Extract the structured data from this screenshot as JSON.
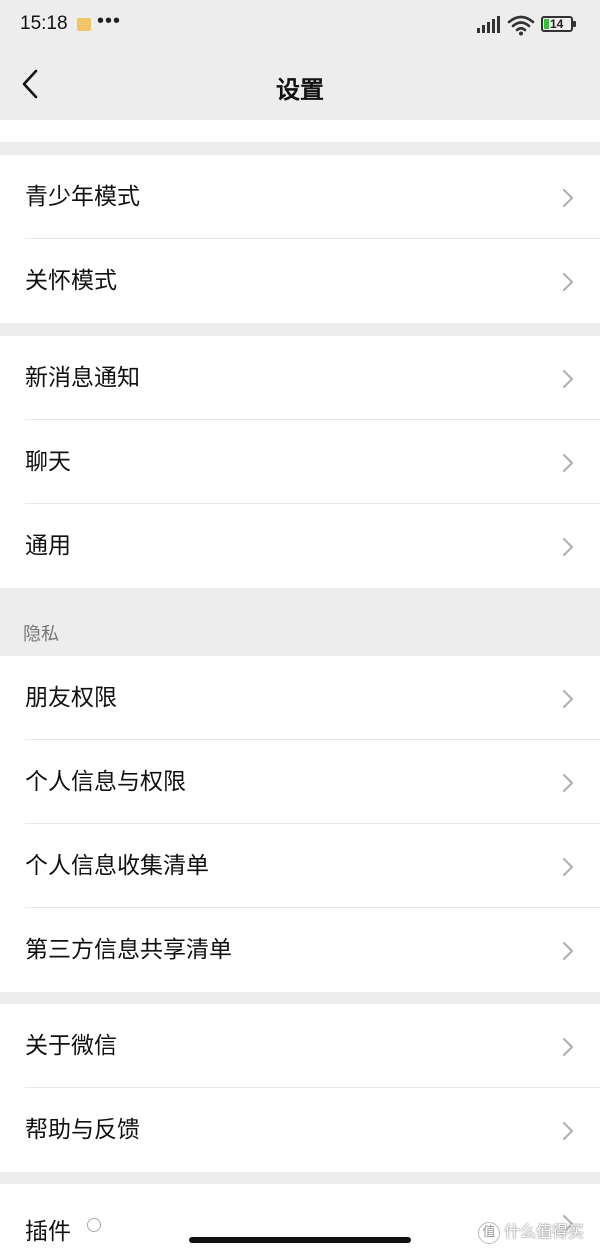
{
  "status_bar": {
    "time": "15:18",
    "dots": "•••",
    "battery_level": "14"
  },
  "nav": {
    "title": "设置"
  },
  "sections": [
    {
      "items": [
        {
          "label": "青少年模式"
        },
        {
          "label": "关怀模式"
        }
      ]
    },
    {
      "items": [
        {
          "label": "新消息通知"
        },
        {
          "label": "聊天"
        },
        {
          "label": "通用"
        }
      ]
    },
    {
      "header": "隐私",
      "items": [
        {
          "label": "朋友权限"
        },
        {
          "label": "个人信息与权限"
        },
        {
          "label": "个人信息收集清单"
        },
        {
          "label": "第三方信息共享清单"
        }
      ]
    },
    {
      "items": [
        {
          "label": "关于微信"
        },
        {
          "label": "帮助与反馈"
        }
      ]
    },
    {
      "items": [
        {
          "label": "插件"
        }
      ]
    }
  ],
  "watermark": {
    "badge": "值",
    "text": "什么值得买"
  },
  "colors": {
    "background": "#ededed",
    "row_background": "#ffffff",
    "chevron": "#b2b2b2",
    "battery_fill": "#3bbf3b"
  },
  "icons": {
    "back": "chevron-left-icon",
    "row": "chevron-right-icon",
    "signal": "signal-icon",
    "wifi": "wifi-icon",
    "battery": "battery-icon",
    "note": "note-icon"
  }
}
